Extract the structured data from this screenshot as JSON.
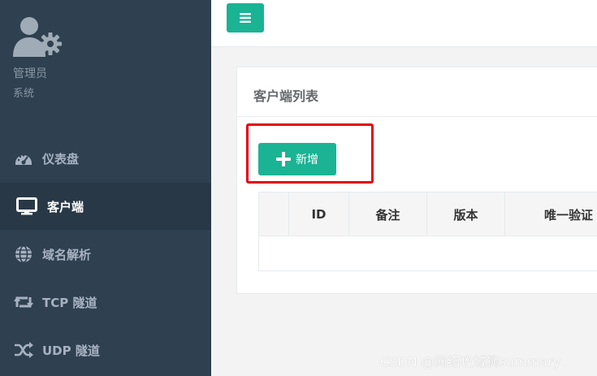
{
  "colors": {
    "sidebar_bg": "#2f4050",
    "sidebar_active_bg": "#293846",
    "accent": "#1ab394",
    "highlight": "#e60012"
  },
  "profile": {
    "name": "管理员",
    "role": "系统",
    "avatar_icon": "user-gear-icon"
  },
  "nav": [
    {
      "label": "仪表盘",
      "icon": "dashboard-gauge-icon",
      "active": false
    },
    {
      "label": "客户端",
      "icon": "monitor-icon",
      "active": true
    },
    {
      "label": "域名解析",
      "icon": "globe-icon",
      "active": false
    },
    {
      "label": "TCP 隧道",
      "icon": "retweet-arrows-icon",
      "active": false
    },
    {
      "label": "UDP 隧道",
      "icon": "shuffle-icon",
      "active": false
    }
  ],
  "topbar": {
    "menu_icon": "hamburger-menu-icon"
  },
  "panel": {
    "title": "客户端列表",
    "add_button_label": "新增",
    "add_button_icon": "plus-icon",
    "table_headers": [
      "",
      "ID",
      "备注",
      "版本",
      "唯一验证"
    ],
    "rows": []
  },
  "watermark": "CSDN @网络攻城狮summary"
}
